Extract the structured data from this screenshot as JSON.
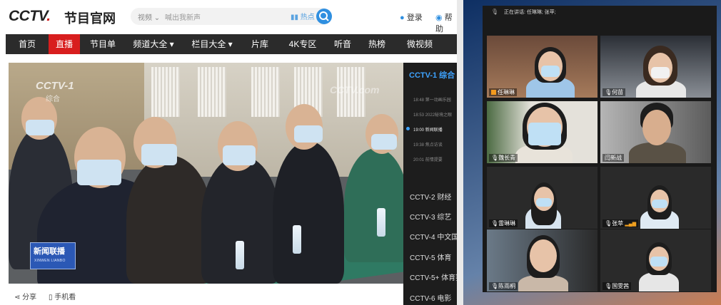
{
  "site": {
    "logo_main": "CCTV",
    "logo_dot": ".",
    "logo_sub": "节目官网",
    "search_scope": "视频 ⌄",
    "search_placeholder": "喊出我新声",
    "search_voice": "热点",
    "login": "登录",
    "help": "帮助"
  },
  "nav": [
    "首页",
    "直播",
    "节目单",
    "频道大全 ▾",
    "栏目大全 ▾",
    "片库",
    "4K专区",
    "听音",
    "热榜",
    "微视频"
  ],
  "player": {
    "watermark_logo": "CCTV-1",
    "watermark_sub": "综合",
    "watermark_right": "CCTV.com",
    "show_badge_cn": "新闻联播",
    "show_badge_en": "XINWEN LIANBO"
  },
  "player_bottom": {
    "share": "分享",
    "phone": "手机看"
  },
  "schedule": {
    "current_channel": "CCTV-1 综合",
    "programs": [
      {
        "time": "18:48",
        "title": "第一动画乐园"
      },
      {
        "time": "18:53",
        "title": "2022秘境之眼"
      },
      {
        "time": "19:00",
        "title": "新闻联播"
      },
      {
        "time": "19:38",
        "title": "焦点访谈"
      },
      {
        "time": "20:01",
        "title": "前情提要"
      }
    ],
    "live_index": 2,
    "channels": [
      "CCTV-2 财经",
      "CCTV-3 综艺",
      "CCTV-4 中文国际",
      "CCTV-5 体育",
      "CCTV-5+ 体育赛事",
      "CCTV-6 电影"
    ]
  },
  "meeting": {
    "speaking": "正在讲话: 任琳琳; 张苹;",
    "participants": [
      "任琳琳",
      "何苗",
      "魏长青",
      "闫新战",
      "雷琳琳",
      "张苹",
      "陈雨桐",
      "国雯茜"
    ]
  },
  "colors": {
    "accent": "#d81e1e",
    "nav_bg": "#2b2b2b",
    "link_blue": "#3ea3ff"
  }
}
